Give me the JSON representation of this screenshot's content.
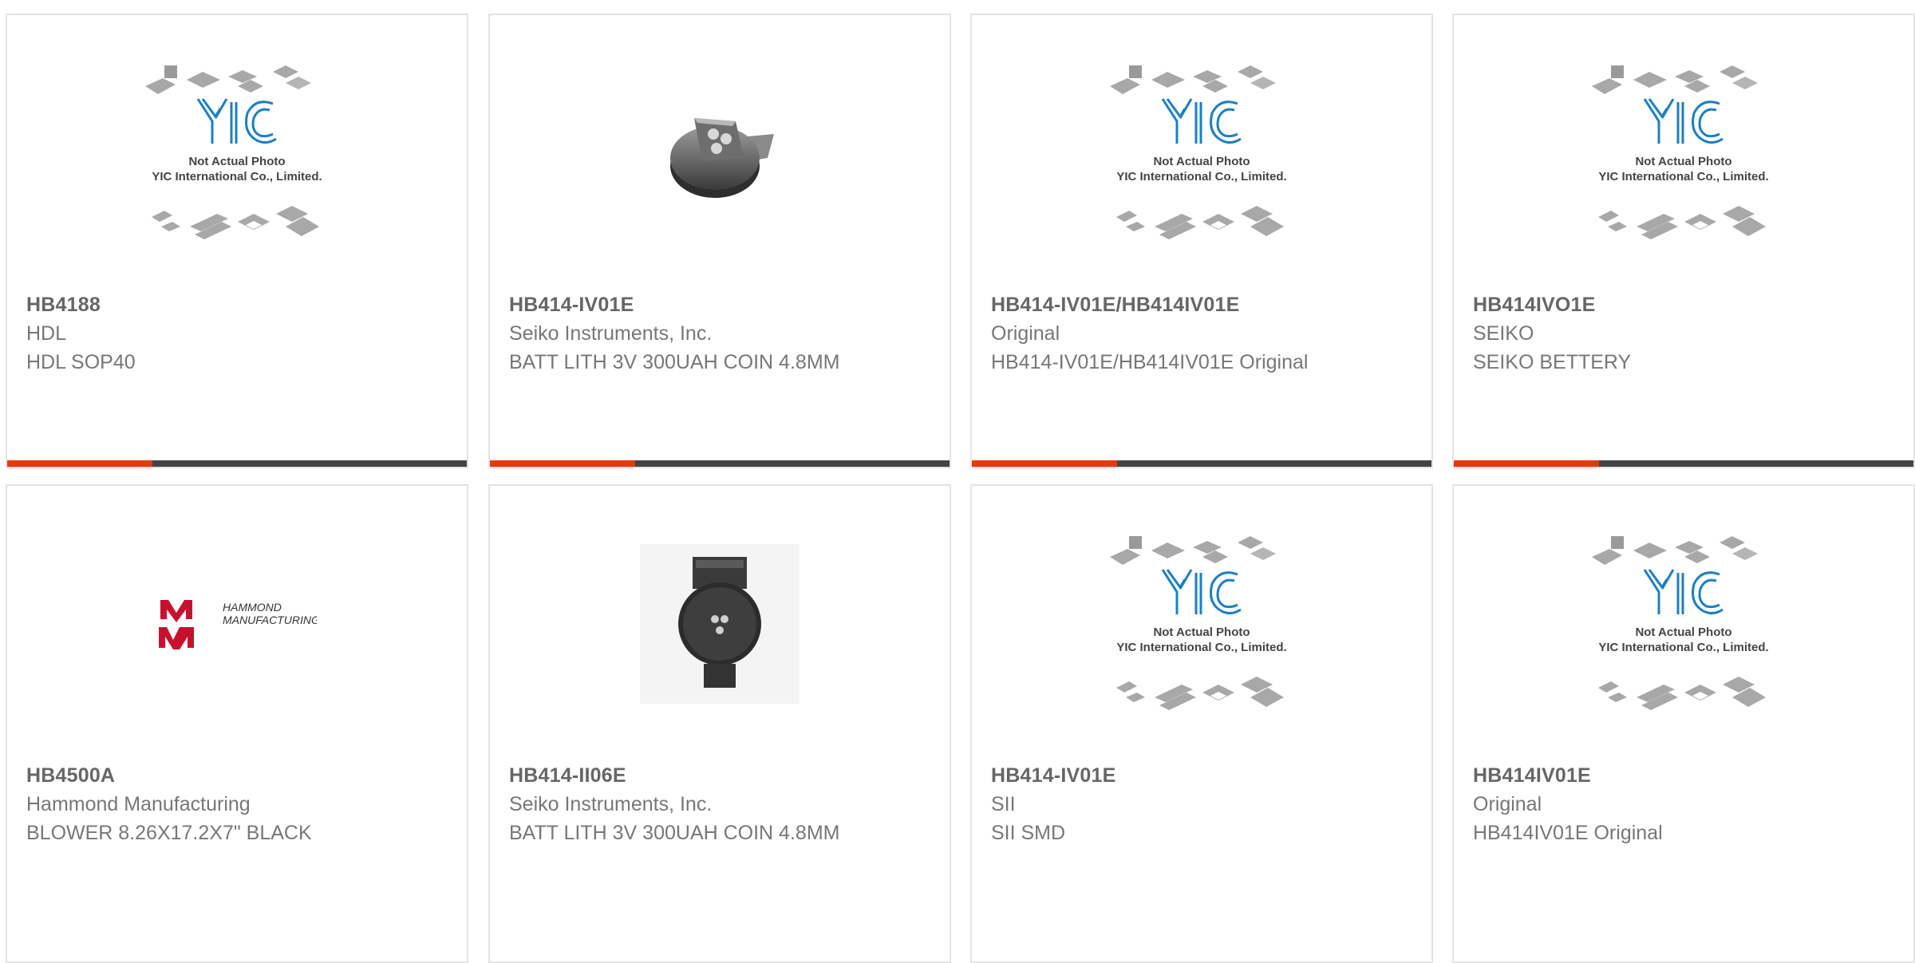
{
  "colors": {
    "accent": "#e8380d",
    "bar": "#444444",
    "card_border": "#e3e3e3",
    "text": "#777777",
    "title": "#666666"
  },
  "products": [
    {
      "part_number": "HB4188",
      "manufacturer": "HDL",
      "description": "HDL SOP40",
      "image": "placeholder",
      "image_text_1": "Not Actual Photo",
      "image_text_2": "YIC International Co., Limited."
    },
    {
      "part_number": "HB414-IV01E",
      "manufacturer": "Seiko Instruments, Inc.",
      "description": "BATT LITH 3V 300UAH COIN 4.8MM",
      "image": "coin-battery-photo"
    },
    {
      "part_number": "HB414-IV01E/HB414IV01E",
      "manufacturer": "Original",
      "description": "HB414-IV01E/HB414IV01E Original",
      "image": "placeholder",
      "image_text_1": "Not Actual Photo",
      "image_text_2": "YIC International Co., Limited."
    },
    {
      "part_number": "HB414IVO1E",
      "manufacturer": "SEIKO",
      "description": "SEIKO BETTERY",
      "image": "placeholder",
      "image_text_1": "Not Actual Photo",
      "image_text_2": "YIC International Co., Limited."
    },
    {
      "part_number": "HB4500A",
      "manufacturer": "Hammond Manufacturing",
      "description": "BLOWER 8.26X17.2X7\" BLACK",
      "image": "hammond-logo",
      "logo_text_1": "HAMMOND",
      "logo_text_2": "MANUFACTURING."
    },
    {
      "part_number": "HB414-II06E",
      "manufacturer": "Seiko Instruments, Inc.",
      "description": "BATT LITH 3V 300UAH COIN 4.8MM",
      "image": "battery-top-photo"
    },
    {
      "part_number": "HB414-IV01E",
      "manufacturer": "SII",
      "description": "SII SMD",
      "image": "placeholder",
      "image_text_1": "Not Actual Photo",
      "image_text_2": "YIC International Co., Limited."
    },
    {
      "part_number": "HB414IV01E",
      "manufacturer": "Original",
      "description": "HB414IV01E Original",
      "image": "placeholder",
      "image_text_1": "Not Actual Photo",
      "image_text_2": "YIC International Co., Limited."
    }
  ]
}
